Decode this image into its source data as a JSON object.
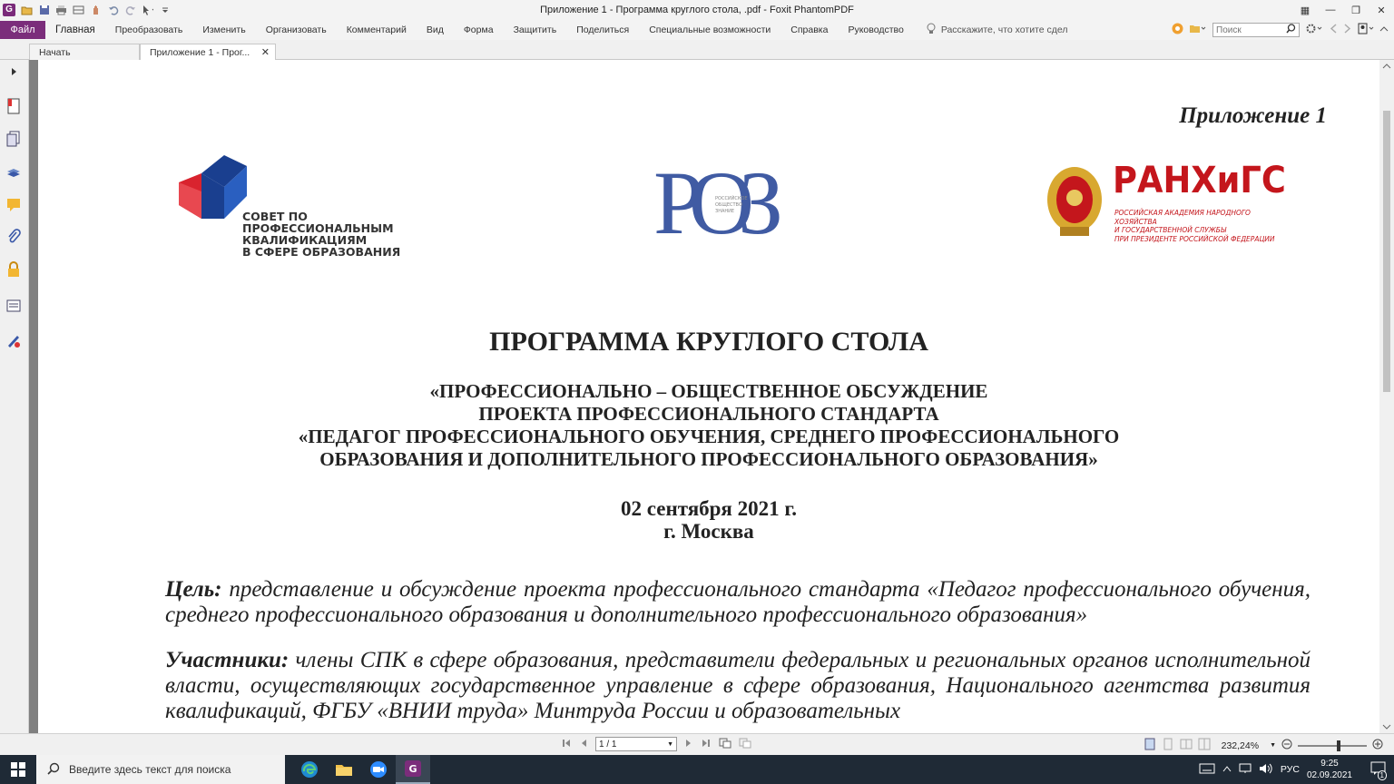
{
  "window": {
    "title": "Приложение 1 - Программа круглого стола, .pdf - Foxit PhantomPDF"
  },
  "ribbon": {
    "file_tab": "Файл",
    "tabs": [
      "Главная",
      "Преобразовать",
      "Изменить",
      "Организовать",
      "Комментарий",
      "Вид",
      "Форма",
      "Защитить",
      "Поделиться",
      "Специальные возможности",
      "Справка",
      "Руководство"
    ],
    "active_tab_index": 0,
    "tell_me": "Расскажите, что хотите сдел",
    "search_placeholder": "Поиск"
  },
  "doc_tabs": {
    "start": "Начать",
    "current": "Приложение 1 - Прог..."
  },
  "document": {
    "appendix": "Приложение 1",
    "logos": {
      "spk_text": [
        "СОВЕТ ПО ПРОФЕССИОНАЛЬНЫМ",
        "КВАЛИФИКАЦИЯМ",
        "В СФЕРЕ ОБРАЗОВАНИЯ"
      ],
      "roz_letters": "РОЗ",
      "roz_text": [
        "РОССИЙСКОЕ",
        "ОБЩЕСТВО",
        "ЗНАНИЕ"
      ],
      "ran_name": "РАНХиГС",
      "ran_text": [
        "РОССИЙСКАЯ АКАДЕМИЯ НАРОДНОГО ХОЗЯЙСТВА",
        "И ГОСУДАРСТВЕННОЙ СЛУЖБЫ",
        "ПРИ ПРЕЗИДЕНТЕ РОССИЙСКОЙ ФЕДЕРАЦИИ"
      ]
    },
    "title": "ПРОГРАММА КРУГЛОГО СТОЛА",
    "subtitle_lines": [
      "«ПРОФЕССИОНАЛЬНО – ОБЩЕСТВЕННОЕ ОБСУЖДЕНИЕ",
      "ПРОЕКТА ПРОФЕССИОНАЛЬНОГО СТАНДАРТА",
      "«ПЕДАГОГ ПРОФЕССИОНАЛЬНОГО ОБУЧЕНИЯ, СРЕДНЕГО ПРОФЕССИОНАЛЬНОГО",
      "ОБРАЗОВАНИЯ И ДОПОЛНИТЕЛЬНОГО ПРОФЕССИОНАЛЬНОГО ОБРАЗОВАНИЯ»"
    ],
    "date": "02 сентября 2021 г.",
    "city": "г. Москва",
    "goal_label": "Цель:",
    "goal_text": " представление и обсуждение проекта профессионального стандарта «Педагог профессионального обучения, среднего профессионального образования и дополнительного профессионального образования»",
    "participants_label": "Участники:",
    "participants_text": " члены СПК в сфере образования, представители федеральных и региональных органов исполнительной власти, осуществляющих государственное управление в сфере образования, Национального агентства развития квалификаций, ФГБУ «ВНИИ труда» Минтруда России и образовательных"
  },
  "status": {
    "page": "1 / 1",
    "zoom": "232,24%",
    "zoom_fraction": 0.6
  },
  "taskbar": {
    "search_placeholder": "Введите здесь текст для поиска",
    "lang": "РУС",
    "time": "9:25",
    "date": "02.09.2021",
    "notification_count": "1"
  },
  "colors": {
    "accent": "#7b2d7b",
    "spk_red": "#d9232e",
    "spk_blue": "#1a3f8f",
    "roz_blue": "#2c4a9a",
    "roz_red": "#c8283a",
    "ran_red": "#c4161c"
  }
}
